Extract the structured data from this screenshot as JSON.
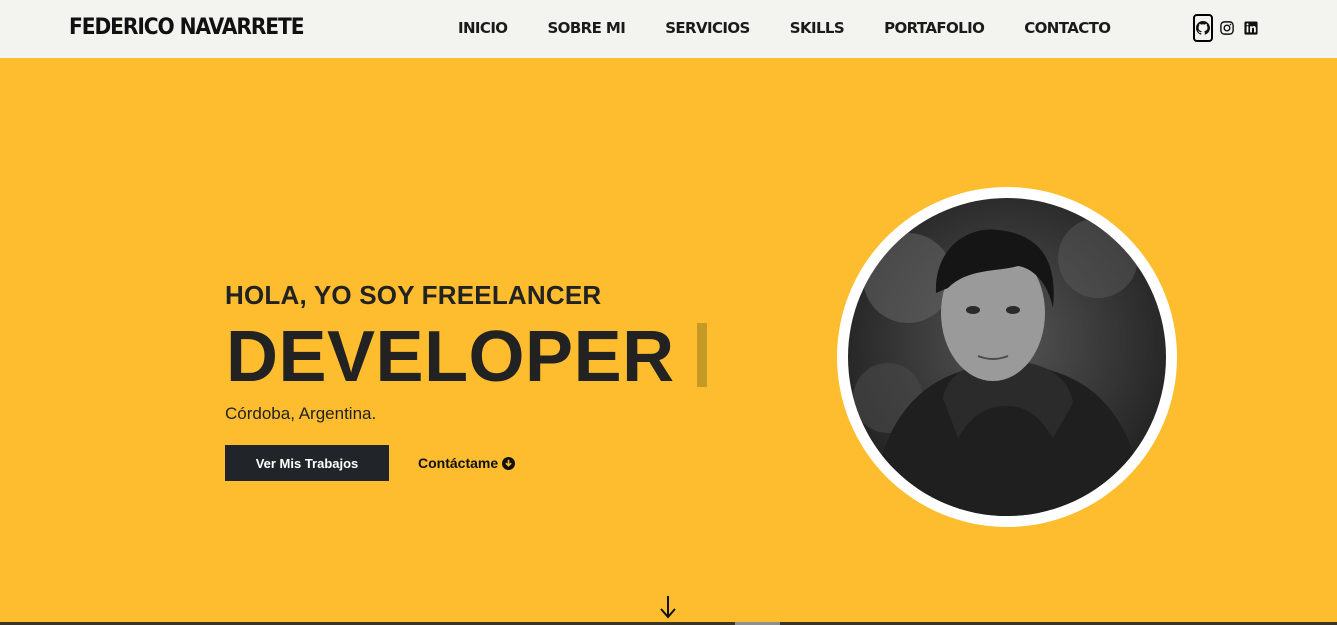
{
  "navbar": {
    "brand": "FEDERICO NAVARRETE",
    "links": [
      "INICIO",
      "SOBRE MI",
      "SERVICIOS",
      "SKILLS",
      "PORTAFOLIO",
      "CONTACTO"
    ],
    "socials": [
      "github-icon",
      "instagram-icon",
      "linkedin-icon"
    ]
  },
  "hero": {
    "greeting": "HOLA, YO SOY FREELANCER",
    "role": "DEVELOPER",
    "location": "Córdoba, Argentina.",
    "primary_button": "Ver Mis Trabajos",
    "contact_link": "Contáctame",
    "scroll_icon": "arrow-down-icon",
    "profile_image": "profile-photo"
  },
  "colors": {
    "background": "#fdbd2f",
    "navbar": "#f3f3ef",
    "dark": "#212529",
    "cursor": "#c49a24"
  }
}
